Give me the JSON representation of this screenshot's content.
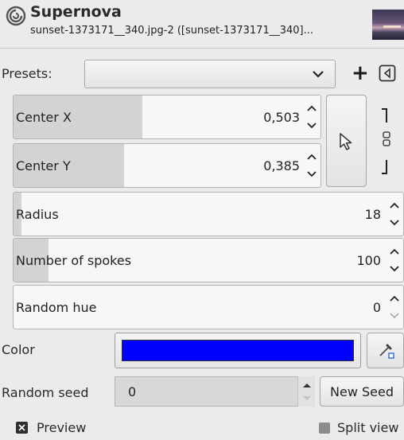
{
  "header": {
    "title": "Supernova",
    "subtitle": "sunset-1373171__340.jpg-2 ([sunset-1373171__340]..."
  },
  "presets": {
    "label": "Presets:",
    "value": "",
    "add_label": "+"
  },
  "center_x": {
    "label": "Center X",
    "value": "0,503",
    "fraction": 0.42
  },
  "center_y": {
    "label": "Center Y",
    "value": "0,385",
    "fraction": 0.36
  },
  "radius": {
    "label": "Radius",
    "value": "18",
    "fraction": 0.02
  },
  "spokes": {
    "label": "Number of spokes",
    "value": "100",
    "fraction": 0.09
  },
  "random_hue": {
    "label": "Random hue",
    "value": "0",
    "fraction": 0.0
  },
  "color": {
    "label": "Color",
    "swatch": "#0000ff"
  },
  "seed": {
    "label": "Random seed",
    "value": "0",
    "button": "New Seed"
  },
  "footer": {
    "preview_label": "Preview",
    "preview_checked": true,
    "split_label": "Split view",
    "split_checked": false
  },
  "icons": [
    "gimp-filter-icon",
    "chevron-down-icon",
    "plus-icon",
    "menu-icon",
    "pointer-icon",
    "chain-icon",
    "color-picker-icon"
  ]
}
